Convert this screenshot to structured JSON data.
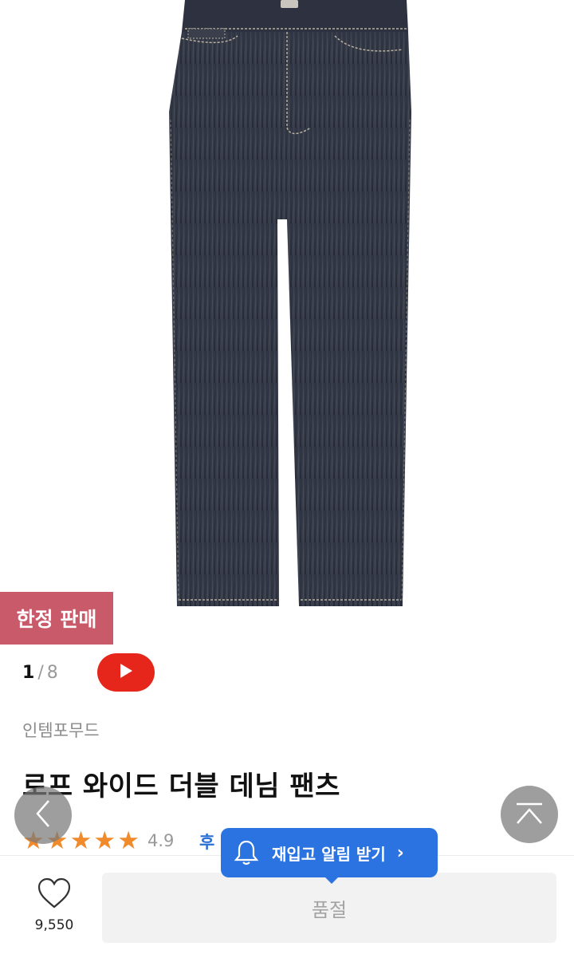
{
  "product": {
    "image_alt": "dark denim wide pants",
    "badge": "한정 판매",
    "counter_current": "1",
    "counter_sep": "/",
    "counter_total": "8",
    "brand": "인템포무드",
    "title": "로프 와이드 더블 데님 팬츠",
    "rating_stars": 5,
    "rating_value": "4.9",
    "review_link_fragment": "후"
  },
  "tooltip": {
    "label": "재입고 알림 받기",
    "chevron": "›"
  },
  "bottom": {
    "wishlist_count": "9,550",
    "soldout_label": "품절"
  },
  "icons": {
    "video": "play-icon",
    "prev": "chevron-left-icon",
    "top": "scroll-top-icon",
    "bell": "bell-icon",
    "heart": "heart-icon"
  },
  "colors": {
    "badge": "#c85a6a",
    "video": "#e7261b",
    "star": "#f08a2a",
    "tooltip": "#2a73e0",
    "review": "#2a6fd6"
  }
}
